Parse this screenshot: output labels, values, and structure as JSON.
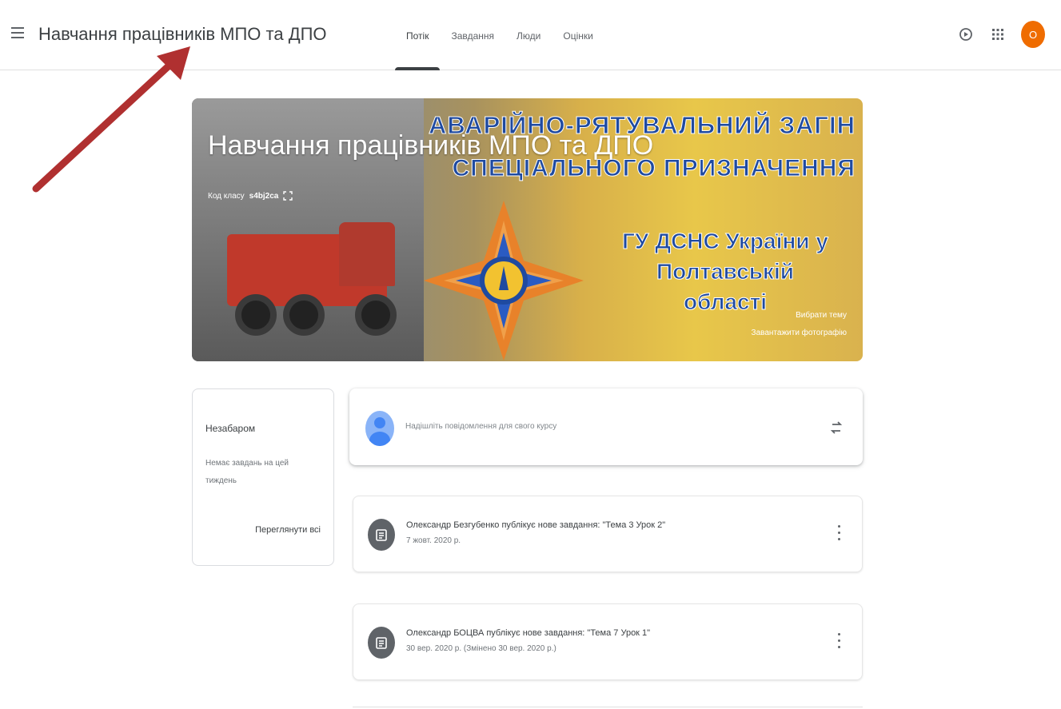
{
  "header": {
    "course_title": "Навчання працівників МПО та ДПО",
    "tabs": [
      {
        "label": "Потік",
        "active": true
      },
      {
        "label": "Завдання",
        "active": false
      },
      {
        "label": "Люди",
        "active": false
      },
      {
        "label": "Оцінки",
        "active": false
      }
    ],
    "avatar_letter": "О",
    "icons": [
      "menu-icon",
      "open-in-drive-icon",
      "apps-grid-icon"
    ]
  },
  "banner": {
    "title": "Навчання працівників МПО та ДПО",
    "class_code_label": "Код класу",
    "class_code": "s4bj2ca",
    "headline_line1": "АВАРІЙНО-РЯТУВАЛЬНИЙ ЗАГІН",
    "headline_line2": "СПЕЦІАЛЬНОГО ПРИЗНАЧЕННЯ",
    "region_line1": "ГУ ДСНС України у Полтавській",
    "region_line2": "області",
    "select_theme": "Вибрати тему",
    "upload_photo": "Завантажити фотографію"
  },
  "upcoming": {
    "title": "Незабаром",
    "empty_text": "Немає завдань на цей тиждень",
    "view_all": "Переглянути всі"
  },
  "announce": {
    "placeholder": "Надішліть повідомлення для свого курсу"
  },
  "posts": [
    {
      "text": "Олександр Безгубенко публікує нове завдання: \"Тема 3 Урок 2\"",
      "date": "7 жовт. 2020 р."
    },
    {
      "text": "Олександр БОЦВА публікує нове завдання: \"Тема 7 Урок 1\"",
      "date": "30 вер. 2020 р. (Змінено 30 вер. 2020 р.)"
    }
  ],
  "colors": {
    "accent": "#ef6c00",
    "banner_text": "#1f4aa0",
    "annotation_arrow": "#b03030"
  }
}
